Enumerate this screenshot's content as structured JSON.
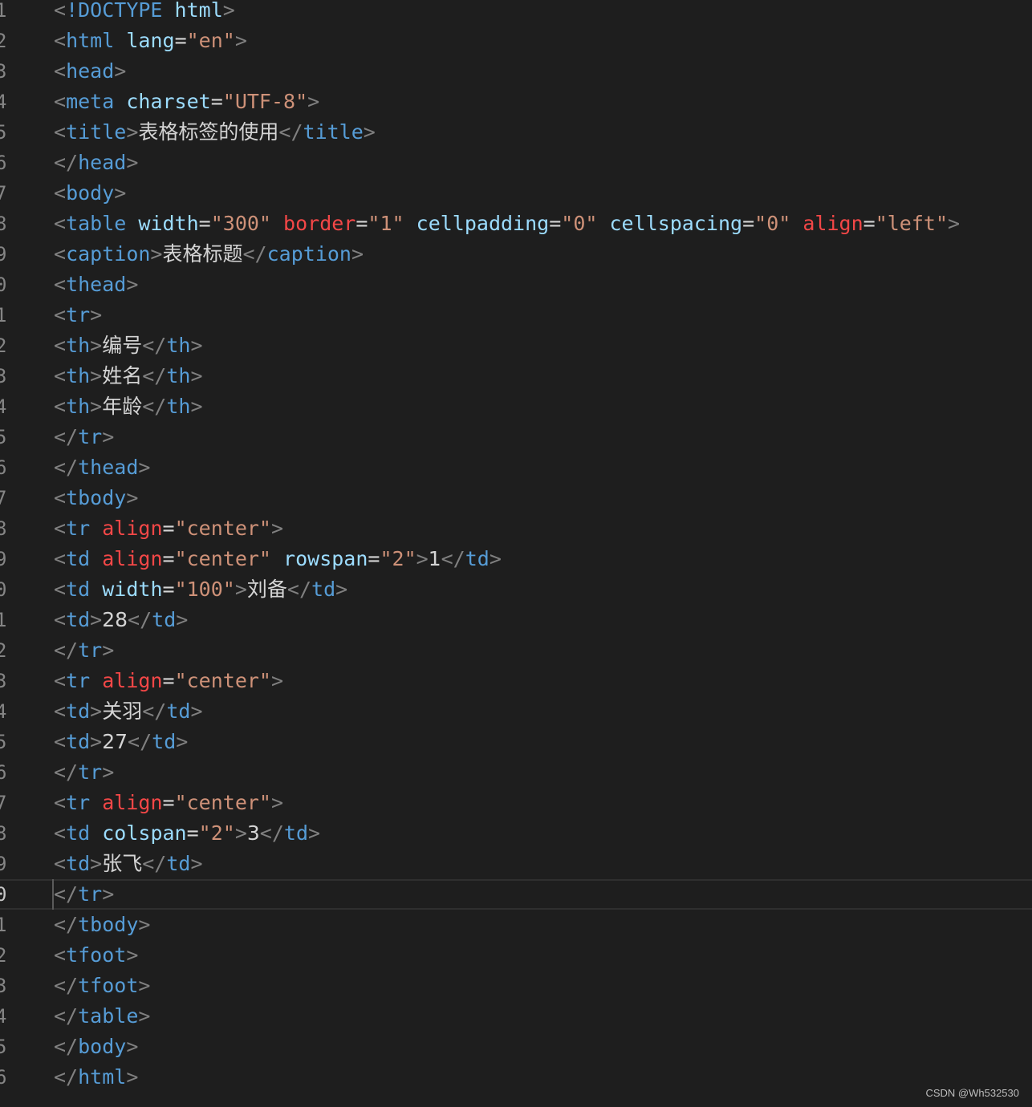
{
  "colors": {
    "background": "#1e1e1e",
    "line_number": "#858585",
    "punctuation": "#808080",
    "tag": "#569cd6",
    "attribute": "#9cdcfe",
    "deprecated_attribute": "#f44747",
    "string": "#ce9178",
    "text": "#d4d4d4"
  },
  "watermark": "CSDN @Wh532530",
  "lines": [
    {
      "num": "1",
      "tokens": [
        [
          "p",
          "<"
        ],
        [
          "t",
          "!DOCTYPE"
        ],
        [
          "p",
          " "
        ],
        [
          "a",
          "html"
        ],
        [
          "p",
          ">"
        ]
      ]
    },
    {
      "num": "2",
      "tokens": [
        [
          "p",
          "<"
        ],
        [
          "t",
          "html"
        ],
        [
          "p",
          " "
        ],
        [
          "a",
          "lang"
        ],
        [
          "e",
          "="
        ],
        [
          "s",
          "\"en\""
        ],
        [
          "p",
          ">"
        ]
      ]
    },
    {
      "num": "3",
      "tokens": [
        [
          "p",
          "<"
        ],
        [
          "t",
          "head"
        ],
        [
          "p",
          ">"
        ]
      ]
    },
    {
      "num": "4",
      "tokens": [
        [
          "p",
          "<"
        ],
        [
          "t",
          "meta"
        ],
        [
          "p",
          " "
        ],
        [
          "a",
          "charset"
        ],
        [
          "e",
          "="
        ],
        [
          "s",
          "\"UTF-8\""
        ],
        [
          "p",
          ">"
        ]
      ]
    },
    {
      "num": "5",
      "tokens": [
        [
          "p",
          "<"
        ],
        [
          "t",
          "title"
        ],
        [
          "p",
          ">"
        ],
        [
          "x",
          "表格标签的使用"
        ],
        [
          "p",
          "</"
        ],
        [
          "t",
          "title"
        ],
        [
          "p",
          ">"
        ]
      ]
    },
    {
      "num": "6",
      "tokens": [
        [
          "p",
          "</"
        ],
        [
          "t",
          "head"
        ],
        [
          "p",
          ">"
        ]
      ]
    },
    {
      "num": "7",
      "tokens": [
        [
          "p",
          "<"
        ],
        [
          "t",
          "body"
        ],
        [
          "p",
          ">"
        ]
      ]
    },
    {
      "num": "8",
      "tokens": [
        [
          "p",
          "<"
        ],
        [
          "t",
          "table"
        ],
        [
          "p",
          " "
        ],
        [
          "a",
          "width"
        ],
        [
          "e",
          "="
        ],
        [
          "s",
          "\"300\""
        ],
        [
          "p",
          " "
        ],
        [
          "d",
          "border"
        ],
        [
          "e",
          "="
        ],
        [
          "s",
          "\"1\""
        ],
        [
          "p",
          " "
        ],
        [
          "a",
          "cellpadding"
        ],
        [
          "e",
          "="
        ],
        [
          "s",
          "\"0\""
        ],
        [
          "p",
          " "
        ],
        [
          "a",
          "cellspacing"
        ],
        [
          "e",
          "="
        ],
        [
          "s",
          "\"0\""
        ],
        [
          "p",
          " "
        ],
        [
          "d",
          "align"
        ],
        [
          "e",
          "="
        ],
        [
          "s",
          "\"left\""
        ],
        [
          "p",
          ">"
        ]
      ]
    },
    {
      "num": "9",
      "tokens": [
        [
          "p",
          "<"
        ],
        [
          "t",
          "caption"
        ],
        [
          "p",
          ">"
        ],
        [
          "x",
          "表格标题"
        ],
        [
          "p",
          "</"
        ],
        [
          "t",
          "caption"
        ],
        [
          "p",
          ">"
        ]
      ]
    },
    {
      "num": "0",
      "tokens": [
        [
          "p",
          "<"
        ],
        [
          "t",
          "thead"
        ],
        [
          "p",
          ">"
        ]
      ]
    },
    {
      "num": "1",
      "tokens": [
        [
          "p",
          "<"
        ],
        [
          "t",
          "tr"
        ],
        [
          "p",
          ">"
        ]
      ]
    },
    {
      "num": "2",
      "tokens": [
        [
          "p",
          "<"
        ],
        [
          "t",
          "th"
        ],
        [
          "p",
          ">"
        ],
        [
          "x",
          "编号"
        ],
        [
          "p",
          "</"
        ],
        [
          "t",
          "th"
        ],
        [
          "p",
          ">"
        ]
      ]
    },
    {
      "num": "3",
      "tokens": [
        [
          "p",
          "<"
        ],
        [
          "t",
          "th"
        ],
        [
          "p",
          ">"
        ],
        [
          "x",
          "姓名"
        ],
        [
          "p",
          "</"
        ],
        [
          "t",
          "th"
        ],
        [
          "p",
          ">"
        ]
      ]
    },
    {
      "num": "4",
      "tokens": [
        [
          "p",
          "<"
        ],
        [
          "t",
          "th"
        ],
        [
          "p",
          ">"
        ],
        [
          "x",
          "年龄"
        ],
        [
          "p",
          "</"
        ],
        [
          "t",
          "th"
        ],
        [
          "p",
          ">"
        ]
      ]
    },
    {
      "num": "5",
      "tokens": [
        [
          "p",
          "</"
        ],
        [
          "t",
          "tr"
        ],
        [
          "p",
          ">"
        ]
      ]
    },
    {
      "num": "6",
      "tokens": [
        [
          "p",
          "</"
        ],
        [
          "t",
          "thead"
        ],
        [
          "p",
          ">"
        ]
      ]
    },
    {
      "num": "7",
      "tokens": [
        [
          "p",
          "<"
        ],
        [
          "t",
          "tbody"
        ],
        [
          "p",
          ">"
        ]
      ]
    },
    {
      "num": "8",
      "tokens": [
        [
          "p",
          "<"
        ],
        [
          "t",
          "tr"
        ],
        [
          "p",
          " "
        ],
        [
          "d",
          "align"
        ],
        [
          "e",
          "="
        ],
        [
          "s",
          "\"center\""
        ],
        [
          "p",
          ">"
        ]
      ]
    },
    {
      "num": "9",
      "tokens": [
        [
          "p",
          "<"
        ],
        [
          "t",
          "td"
        ],
        [
          "p",
          " "
        ],
        [
          "d",
          "align"
        ],
        [
          "e",
          "="
        ],
        [
          "s",
          "\"center\""
        ],
        [
          "p",
          " "
        ],
        [
          "a",
          "rowspan"
        ],
        [
          "e",
          "="
        ],
        [
          "s",
          "\"2\""
        ],
        [
          "p",
          ">"
        ],
        [
          "x",
          "1"
        ],
        [
          "p",
          "</"
        ],
        [
          "t",
          "td"
        ],
        [
          "p",
          ">"
        ]
      ]
    },
    {
      "num": "0",
      "tokens": [
        [
          "p",
          "<"
        ],
        [
          "t",
          "td"
        ],
        [
          "p",
          " "
        ],
        [
          "a",
          "width"
        ],
        [
          "e",
          "="
        ],
        [
          "s",
          "\"100\""
        ],
        [
          "p",
          ">"
        ],
        [
          "x",
          "刘备"
        ],
        [
          "p",
          "</"
        ],
        [
          "t",
          "td"
        ],
        [
          "p",
          ">"
        ]
      ]
    },
    {
      "num": "1",
      "tokens": [
        [
          "p",
          "<"
        ],
        [
          "t",
          "td"
        ],
        [
          "p",
          ">"
        ],
        [
          "x",
          "28"
        ],
        [
          "p",
          "</"
        ],
        [
          "t",
          "td"
        ],
        [
          "p",
          ">"
        ]
      ]
    },
    {
      "num": "2",
      "tokens": [
        [
          "p",
          "</"
        ],
        [
          "t",
          "tr"
        ],
        [
          "p",
          ">"
        ]
      ]
    },
    {
      "num": "3",
      "tokens": [
        [
          "p",
          "<"
        ],
        [
          "t",
          "tr"
        ],
        [
          "p",
          " "
        ],
        [
          "d",
          "align"
        ],
        [
          "e",
          "="
        ],
        [
          "s",
          "\"center\""
        ],
        [
          "p",
          ">"
        ]
      ]
    },
    {
      "num": "4",
      "tokens": [
        [
          "p",
          "<"
        ],
        [
          "t",
          "td"
        ],
        [
          "p",
          ">"
        ],
        [
          "x",
          "关羽"
        ],
        [
          "p",
          "</"
        ],
        [
          "t",
          "td"
        ],
        [
          "p",
          ">"
        ]
      ]
    },
    {
      "num": "5",
      "tokens": [
        [
          "p",
          "<"
        ],
        [
          "t",
          "td"
        ],
        [
          "p",
          ">"
        ],
        [
          "x",
          "27"
        ],
        [
          "p",
          "</"
        ],
        [
          "t",
          "td"
        ],
        [
          "p",
          ">"
        ]
      ]
    },
    {
      "num": "6",
      "tokens": [
        [
          "p",
          "</"
        ],
        [
          "t",
          "tr"
        ],
        [
          "p",
          ">"
        ]
      ]
    },
    {
      "num": "7",
      "tokens": [
        [
          "p",
          "<"
        ],
        [
          "t",
          "tr"
        ],
        [
          "p",
          " "
        ],
        [
          "d",
          "align"
        ],
        [
          "e",
          "="
        ],
        [
          "s",
          "\"center\""
        ],
        [
          "p",
          ">"
        ]
      ]
    },
    {
      "num": "8",
      "tokens": [
        [
          "p",
          "<"
        ],
        [
          "t",
          "td"
        ],
        [
          "p",
          " "
        ],
        [
          "a",
          "colspan"
        ],
        [
          "e",
          "="
        ],
        [
          "s",
          "\"2\""
        ],
        [
          "p",
          ">"
        ],
        [
          "x",
          "3"
        ],
        [
          "p",
          "</"
        ],
        [
          "t",
          "td"
        ],
        [
          "p",
          ">"
        ]
      ]
    },
    {
      "num": "9",
      "tokens": [
        [
          "p",
          "<"
        ],
        [
          "t",
          "td"
        ],
        [
          "p",
          ">"
        ],
        [
          "x",
          "张飞"
        ],
        [
          "p",
          "</"
        ],
        [
          "t",
          "td"
        ],
        [
          "p",
          ">"
        ]
      ]
    },
    {
      "num": "0",
      "current": true,
      "tokens": [
        [
          "p",
          "</"
        ],
        [
          "t",
          "tr"
        ],
        [
          "p",
          ">"
        ]
      ]
    },
    {
      "num": "1",
      "tokens": [
        [
          "p",
          "</"
        ],
        [
          "t",
          "tbody"
        ],
        [
          "p",
          ">"
        ]
      ]
    },
    {
      "num": "2",
      "tokens": [
        [
          "p",
          "<"
        ],
        [
          "t",
          "tfoot"
        ],
        [
          "p",
          ">"
        ]
      ]
    },
    {
      "num": "3",
      "tokens": [
        [
          "p",
          "</"
        ],
        [
          "t",
          "tfoot"
        ],
        [
          "p",
          ">"
        ]
      ]
    },
    {
      "num": "4",
      "tokens": [
        [
          "p",
          "</"
        ],
        [
          "t",
          "table"
        ],
        [
          "p",
          ">"
        ]
      ]
    },
    {
      "num": "5",
      "tokens": [
        [
          "p",
          "</"
        ],
        [
          "t",
          "body"
        ],
        [
          "p",
          ">"
        ]
      ]
    },
    {
      "num": "6",
      "tokens": [
        [
          "p",
          "</"
        ],
        [
          "t",
          "html"
        ],
        [
          "p",
          ">"
        ]
      ]
    }
  ]
}
